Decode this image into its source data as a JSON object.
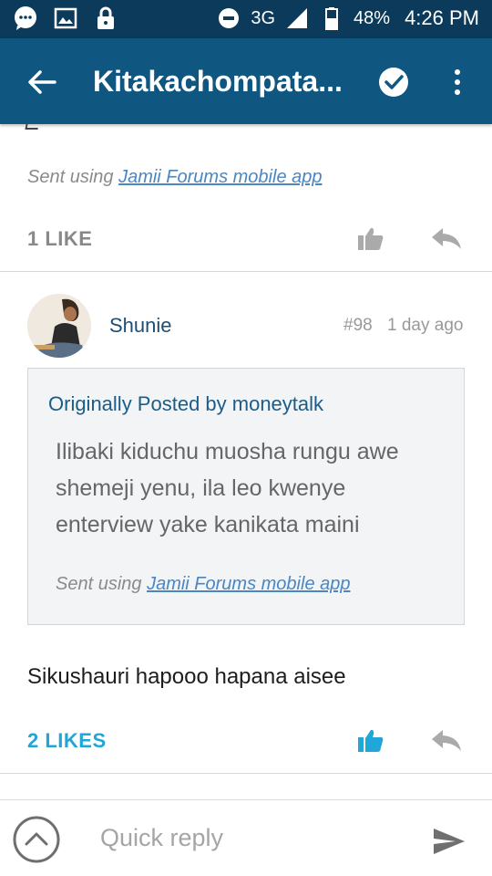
{
  "status_bar": {
    "network": "3G",
    "battery": "48%",
    "time": "4:26 PM"
  },
  "app_bar": {
    "title": "Kitakachompata..."
  },
  "post_prev": {
    "sent_prefix": "Sent using",
    "sent_app": "Jamii Forums mobile app",
    "likes": "1 LIKE"
  },
  "post": {
    "username": "Shunie",
    "number": "#98",
    "time": "1 day ago",
    "quote": {
      "author": "Originally Posted by moneytalk",
      "body": "Ilibaki kiduchu muosha rungu awe shemeji yenu, ila leo kwenye enterview yake kanikata maini",
      "sent_prefix": "Sent using",
      "sent_app": "Jamii Forums mobile app"
    },
    "message": "Sikushauri hapooo hapana aisee",
    "likes": "2 LIKES"
  },
  "reply_bar": {
    "placeholder": "Quick reply"
  },
  "colors": {
    "status_bar": "#0b3a5a",
    "app_bar": "#0f5680",
    "like_active": "#20a7d8",
    "link": "#4a86c4"
  }
}
